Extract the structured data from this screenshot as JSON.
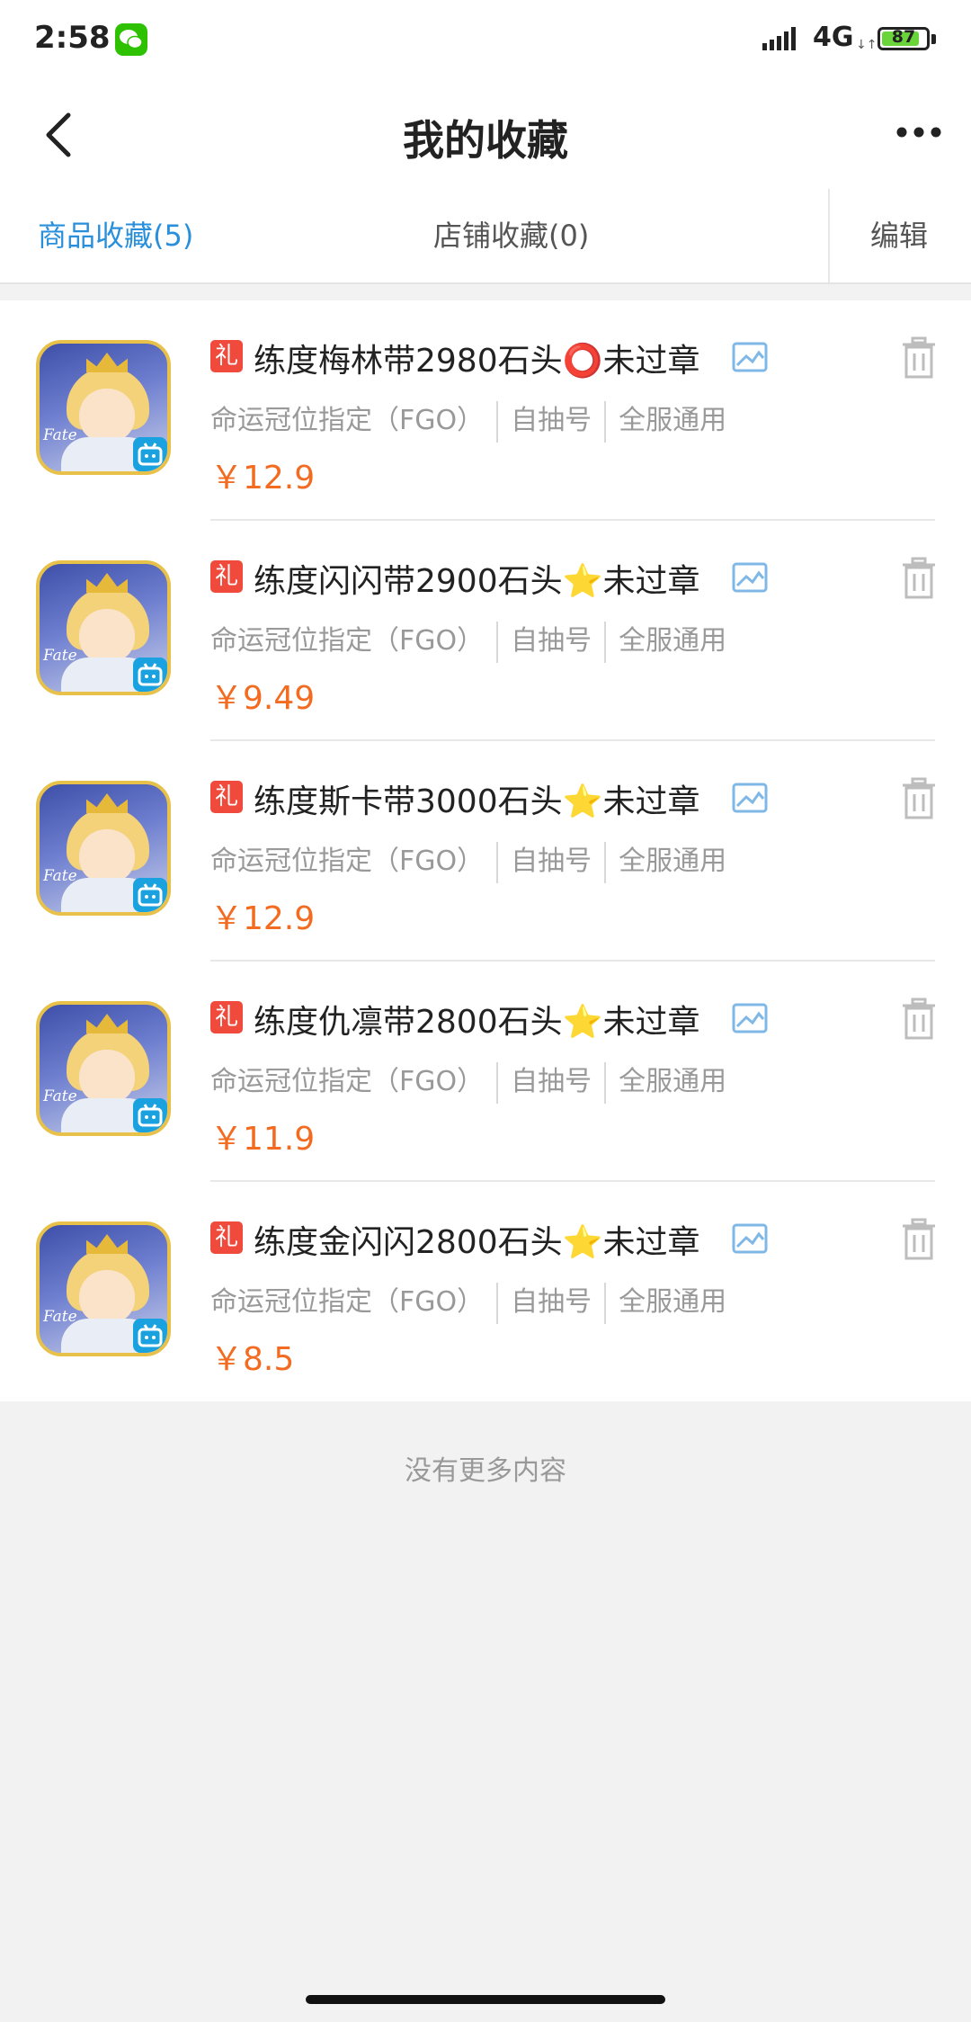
{
  "status_bar": {
    "time": "2:58",
    "network": "4G",
    "network_arrows": "↓↑",
    "battery": "87",
    "battery_level": 0.87,
    "app_icon": "wechat-icon"
  },
  "nav": {
    "title": "我的收藏",
    "back_icon": "chevron-left-icon",
    "more_icon": "more-dots-icon"
  },
  "tabs": {
    "goods": "商品收藏(5)",
    "shops": "店铺收藏(0)",
    "edit": "编辑",
    "active": "goods"
  },
  "colors": {
    "accent_blue": "#2a8fdb",
    "price_orange": "#f26b21",
    "gift_red": "#f04a3c"
  },
  "items": [
    {
      "gift": "礼",
      "title": "练度梅林带2980石头⭕未过章",
      "game": "命运冠位指定（FGO）",
      "tag1": "自抽号",
      "tag2": "全服通用",
      "price": "￥12.9"
    },
    {
      "gift": "礼",
      "title": "练度闪闪带2900石头⭐未过章",
      "game": "命运冠位指定（FGO）",
      "tag1": "自抽号",
      "tag2": "全服通用",
      "price": "￥9.49"
    },
    {
      "gift": "礼",
      "title": "练度斯卡带3000石头⭐未过章",
      "game": "命运冠位指定（FGO）",
      "tag1": "自抽号",
      "tag2": "全服通用",
      "price": "￥12.9"
    },
    {
      "gift": "礼",
      "title": "练度仇凛带2800石头⭐未过章",
      "game": "命运冠位指定（FGO）",
      "tag1": "自抽号",
      "tag2": "全服通用",
      "price": "￥11.9"
    },
    {
      "gift": "礼",
      "title": "练度金闪闪2800石头⭐未过章",
      "game": "命运冠位指定（FGO）",
      "tag1": "自抽号",
      "tag2": "全服通用",
      "price": "￥8.5"
    }
  ],
  "thumb_logo": "Fate",
  "footer": {
    "no_more": "没有更多内容"
  }
}
